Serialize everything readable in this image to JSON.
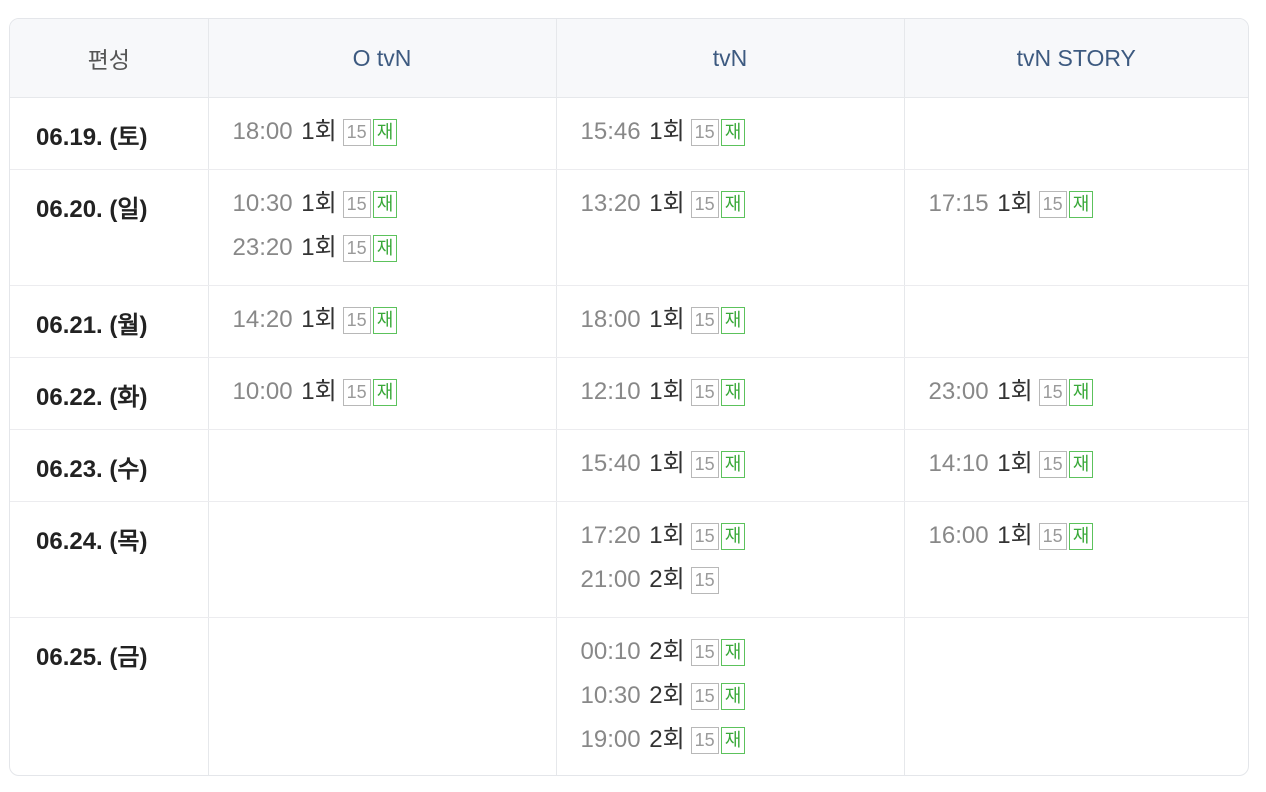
{
  "header": {
    "label": "편성",
    "channels": [
      "O tvN",
      "tvN",
      "tvN STORY"
    ]
  },
  "rows": [
    {
      "date": "06.19. (토)",
      "cells": [
        [
          {
            "time": "18:00",
            "ep": "1회",
            "age": "15",
            "re": "재"
          }
        ],
        [
          {
            "time": "15:46",
            "ep": "1회",
            "age": "15",
            "re": "재"
          }
        ],
        []
      ]
    },
    {
      "date": "06.20. (일)",
      "cells": [
        [
          {
            "time": "10:30",
            "ep": "1회",
            "age": "15",
            "re": "재"
          },
          {
            "time": "23:20",
            "ep": "1회",
            "age": "15",
            "re": "재"
          }
        ],
        [
          {
            "time": "13:20",
            "ep": "1회",
            "age": "15",
            "re": "재"
          }
        ],
        [
          {
            "time": "17:15",
            "ep": "1회",
            "age": "15",
            "re": "재"
          }
        ]
      ]
    },
    {
      "date": "06.21. (월)",
      "cells": [
        [
          {
            "time": "14:20",
            "ep": "1회",
            "age": "15",
            "re": "재"
          }
        ],
        [
          {
            "time": "18:00",
            "ep": "1회",
            "age": "15",
            "re": "재"
          }
        ],
        []
      ]
    },
    {
      "date": "06.22. (화)",
      "cells": [
        [
          {
            "time": "10:00",
            "ep": "1회",
            "age": "15",
            "re": "재"
          }
        ],
        [
          {
            "time": "12:10",
            "ep": "1회",
            "age": "15",
            "re": "재"
          }
        ],
        [
          {
            "time": "23:00",
            "ep": "1회",
            "age": "15",
            "re": "재"
          }
        ]
      ]
    },
    {
      "date": "06.23. (수)",
      "cells": [
        [],
        [
          {
            "time": "15:40",
            "ep": "1회",
            "age": "15",
            "re": "재"
          }
        ],
        [
          {
            "time": "14:10",
            "ep": "1회",
            "age": "15",
            "re": "재"
          }
        ]
      ]
    },
    {
      "date": "06.24. (목)",
      "cells": [
        [],
        [
          {
            "time": "17:20",
            "ep": "1회",
            "age": "15",
            "re": "재"
          },
          {
            "time": "21:00",
            "ep": "2회",
            "age": "15",
            "re": ""
          }
        ],
        [
          {
            "time": "16:00",
            "ep": "1회",
            "age": "15",
            "re": "재"
          }
        ]
      ]
    },
    {
      "date": "06.25. (금)",
      "cells": [
        [],
        [
          {
            "time": "00:10",
            "ep": "2회",
            "age": "15",
            "re": "재"
          },
          {
            "time": "10:30",
            "ep": "2회",
            "age": "15",
            "re": "재"
          },
          {
            "time": "19:00",
            "ep": "2회",
            "age": "15",
            "re": "재"
          }
        ],
        []
      ]
    }
  ],
  "colors": {
    "channel_header": "#3d5a80",
    "rerun_badge": "#3aa93a",
    "age_badge": "#9a9a9a"
  }
}
